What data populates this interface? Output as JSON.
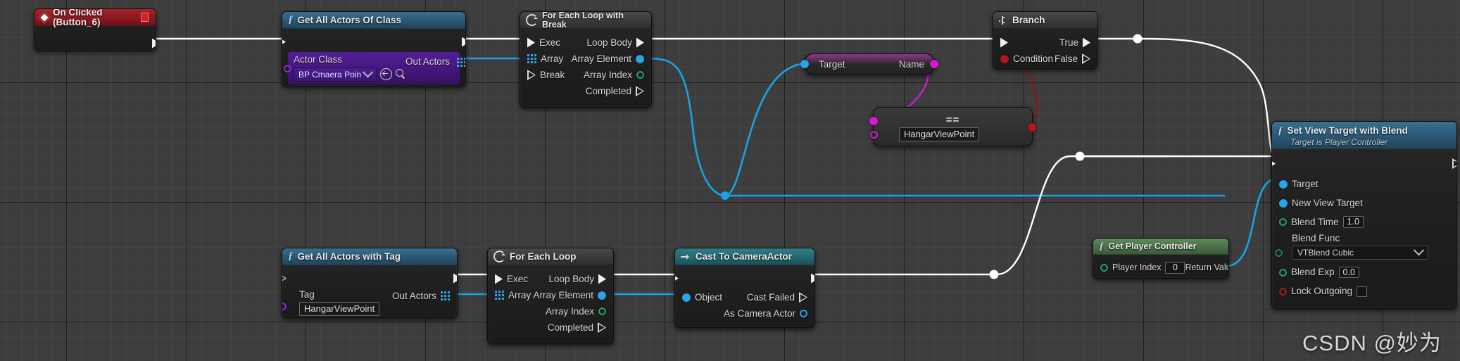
{
  "app": {
    "watermark": "CSDN @妙为"
  },
  "nodes": {
    "on_clicked": {
      "title": "On Clicked (Button_6)",
      "icon": "event-diamond-icon",
      "header_color": "#8e1b22"
    },
    "get_all_actors_of_class": {
      "title": "Get All Actors Of Class",
      "icon": "function-f-icon",
      "header_color": "#2d5c79",
      "param_label": "Actor Class",
      "param_value": "BP Cmaera Poin",
      "out_label": "Out Actors"
    },
    "for_each_loop_with_break": {
      "title": "For Each Loop with Break",
      "icon": "loop-icon",
      "header_color": "#3b3b3b",
      "in_exec": "Exec",
      "in_array": "Array",
      "in_break": "Break",
      "out_loop_body": "Loop Body",
      "out_array_element": "Array Element",
      "out_array_index": "Array Index",
      "out_completed": "Completed"
    },
    "target_name_getter": {
      "in_label": "Target",
      "out_label": "Name"
    },
    "equal_name": {
      "operator": "==",
      "value": "HangarViewPoint"
    },
    "branch": {
      "title": "Branch",
      "icon": "branch-icon",
      "header_color": "#3b3b3b",
      "in_condition": "Condition",
      "out_true": "True",
      "out_false": "False"
    },
    "get_all_actors_with_tag": {
      "title": "Get All Actors with Tag",
      "icon": "function-f-icon",
      "header_color": "#2d5c79",
      "in_tag_label": "Tag",
      "in_tag_value": "HangarViewPoint",
      "out_label": "Out Actors"
    },
    "for_each_loop": {
      "title": "For Each Loop",
      "icon": "loop-icon",
      "header_color": "#3b3b3b",
      "in_exec": "Exec",
      "in_array": "Array",
      "out_loop_body": "Loop Body",
      "out_array_element": "Array Element",
      "out_array_index": "Array Index",
      "out_completed": "Completed"
    },
    "cast_to_camera_actor": {
      "title": "Cast To CameraActor",
      "icon": "cast-arrow-icon",
      "header_color": "#266a73",
      "in_object": "Object",
      "out_cast_failed": "Cast Failed",
      "out_as_camera_actor": "As Camera Actor"
    },
    "get_player_controller": {
      "title": "Get Player Controller",
      "icon": "function-f-icon",
      "header_color": "#4d7249",
      "in_player_index_label": "Player Index",
      "in_player_index_value": "0",
      "out_return_value": "Return Value"
    },
    "set_view_target_with_blend": {
      "title": "Set View Target with Blend",
      "subtitle": "Target is Player Controller",
      "icon": "function-f-icon",
      "header_color": "#2d5c79",
      "in_target": "Target",
      "in_new_view_target": "New View Target",
      "in_blend_time_label": "Blend Time",
      "in_blend_time_value": "1.0",
      "in_blend_func_label": "Blend Func",
      "in_blend_func_value": "VTBlend Cubic",
      "in_blend_exp_label": "Blend Exp",
      "in_blend_exp_value": "0.0",
      "in_lock_outgoing_label": "Lock Outgoing"
    }
  },
  "wire_colors": {
    "exec": "#ffffff",
    "object": "#19a3e8",
    "name": "#d41ad4",
    "bool": "#8a1818"
  }
}
